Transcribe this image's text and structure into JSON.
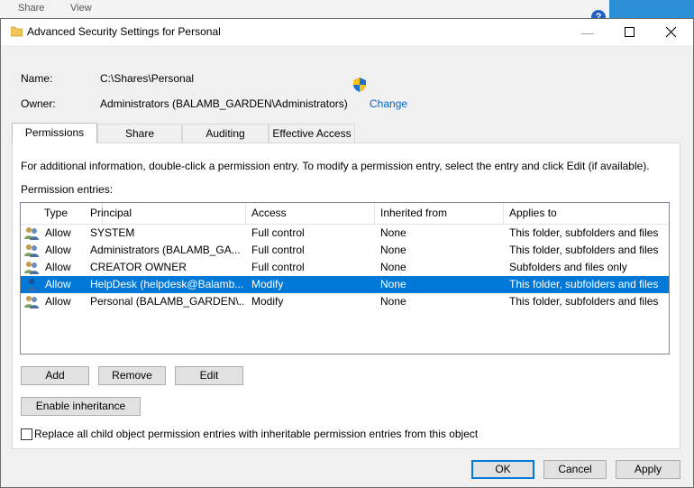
{
  "background_window": {
    "menu_items": [
      "Share",
      "View"
    ]
  },
  "window": {
    "title": "Advanced Security Settings for Personal",
    "minimize_glyph": "—",
    "maximize_glyph": "☐",
    "close_glyph": "✕"
  },
  "info": {
    "name_label": "Name:",
    "name_value": "C:\\Shares\\Personal",
    "owner_label": "Owner:",
    "owner_value": "Administrators (BALAMB_GARDEN\\Administrators)",
    "change_link": "Change"
  },
  "tabs": [
    {
      "label": "Permissions",
      "active": true
    },
    {
      "label": "Share",
      "active": false
    },
    {
      "label": "Auditing",
      "active": false
    },
    {
      "label": "Effective Access",
      "active": false
    }
  ],
  "permissions": {
    "help_text": "For additional information, double-click a permission entry. To modify a permission entry, select the entry and click Edit (if available).",
    "entries_label": "Permission entries:",
    "columns": [
      "Type",
      "Principal",
      "Access",
      "Inherited from",
      "Applies to"
    ],
    "rows": [
      {
        "icon": "group-icon",
        "type": "Allow",
        "principal": "SYSTEM",
        "access": "Full control",
        "inherited": "None",
        "applies": "This folder, subfolders and files",
        "selected": false
      },
      {
        "icon": "group-icon",
        "type": "Allow",
        "principal": "Administrators (BALAMB_GA...",
        "access": "Full control",
        "inherited": "None",
        "applies": "This folder, subfolders and files",
        "selected": false
      },
      {
        "icon": "group-icon",
        "type": "Allow",
        "principal": "CREATOR OWNER",
        "access": "Full control",
        "inherited": "None",
        "applies": "Subfolders and files only",
        "selected": false
      },
      {
        "icon": "user-icon",
        "type": "Allow",
        "principal": "HelpDesk (helpdesk@Balamb...",
        "access": "Modify",
        "inherited": "None",
        "applies": "This folder, subfolders and files",
        "selected": true
      },
      {
        "icon": "group-icon",
        "type": "Allow",
        "principal": "Personal (BALAMB_GARDEN\\...",
        "access": "Modify",
        "inherited": "None",
        "applies": "This folder, subfolders and files",
        "selected": false
      }
    ],
    "add_button": "Add",
    "remove_button": "Remove",
    "edit_button": "Edit",
    "enable_inheritance_button": "Enable inheritance",
    "replace_checkbox_label": "Replace all child object permission entries with inheritable permission entries from this object",
    "replace_checked": false
  },
  "footer": {
    "ok": "OK",
    "cancel": "Cancel",
    "apply": "Apply"
  },
  "colors": {
    "selection": "#0078d7",
    "link": "#0066cc",
    "accent_blue": "#2b8fd6"
  }
}
